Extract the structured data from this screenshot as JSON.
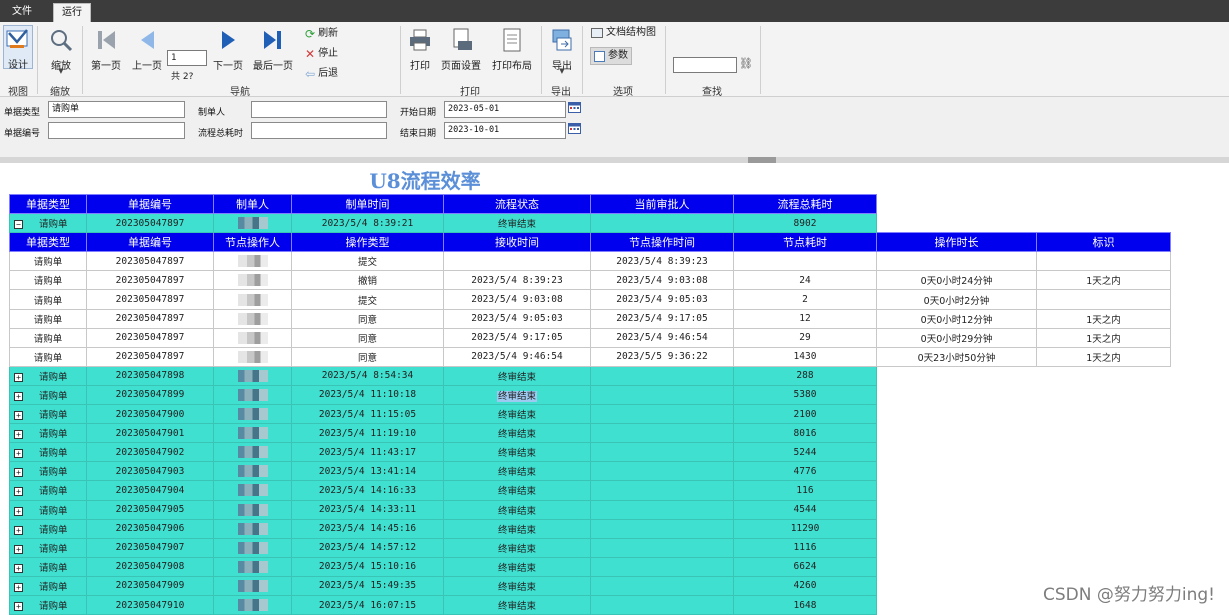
{
  "menu": {
    "file": "文件",
    "run": "运行"
  },
  "ribbon": {
    "design": "设计",
    "zoom": "缩放",
    "first_page": "第一页",
    "prev_page": "上一页",
    "next_page": "下一页",
    "last_page": "最后一页",
    "page_value": "1",
    "page_total": "共 2?",
    "refresh": "刷新",
    "stop": "停止",
    "back": "后退",
    "print": "打印",
    "page_setup": "页面设置",
    "print_layout": "打印布局",
    "export": "导出",
    "doc_structure": "文档结构图",
    "params": "参数",
    "groups": {
      "view": "视图",
      "zoom": "缩放",
      "nav": "导航",
      "print": "打印",
      "export": "导出",
      "options": "选项",
      "find": "查找"
    }
  },
  "filters": {
    "doc_type_label": "单据类型",
    "doc_type_value": "请购单",
    "doc_no_label": "单据编号",
    "doc_no_value": "",
    "creator_label": "制单人",
    "creator_value": "",
    "total_time_label": "流程总耗时",
    "total_time_value": "",
    "start_date_label": "开始日期",
    "start_date_value": "2023-05-01",
    "end_date_label": "结束日期",
    "end_date_value": "2023-10-01"
  },
  "report": {
    "title": "U8流程效率",
    "header1": [
      "单据类型",
      "单据编号",
      "制单人",
      "制单时间",
      "流程状态",
      "当前审批人",
      "流程总耗时"
    ],
    "expanded_row": {
      "type": "请购单",
      "no": "202305047897",
      "time": "2023/5/4 8:39:21",
      "status": "终审结束",
      "approver": "",
      "total": "8902"
    },
    "header2": [
      "单据类型",
      "单据编号",
      "节点操作人",
      "操作类型",
      "接收时间",
      "节点操作时间",
      "节点耗时",
      "操作时长",
      "标识"
    ],
    "detail_rows": [
      {
        "type": "请购单",
        "no": "202305047897",
        "op": "提交",
        "recv": "",
        "optime": "2023/5/4 8:39:23",
        "cost": "",
        "dur": "",
        "flag": ""
      },
      {
        "type": "请购单",
        "no": "202305047897",
        "op": "撤销",
        "recv": "2023/5/4 8:39:23",
        "optime": "2023/5/4 9:03:08",
        "cost": "24",
        "dur": "0天0小时24分钟",
        "flag": "1天之内"
      },
      {
        "type": "请购单",
        "no": "202305047897",
        "op": "提交",
        "recv": "2023/5/4 9:03:08",
        "optime": "2023/5/4 9:05:03",
        "cost": "2",
        "dur": "0天0小时2分钟",
        "flag": ""
      },
      {
        "type": "请购单",
        "no": "202305047897",
        "op": "同意",
        "recv": "2023/5/4 9:05:03",
        "optime": "2023/5/4 9:17:05",
        "cost": "12",
        "dur": "0天0小时12分钟",
        "flag": "1天之内"
      },
      {
        "type": "请购单",
        "no": "202305047897",
        "op": "同意",
        "recv": "2023/5/4 9:17:05",
        "optime": "2023/5/4 9:46:54",
        "cost": "29",
        "dur": "0天0小时29分钟",
        "flag": "1天之内"
      },
      {
        "type": "请购单",
        "no": "202305047897",
        "op": "同意",
        "recv": "2023/5/4 9:46:54",
        "optime": "2023/5/5 9:36:22",
        "cost": "1430",
        "dur": "0天23小时50分钟",
        "flag": "1天之内"
      }
    ],
    "summary_rows": [
      {
        "type": "请购单",
        "no": "202305047898",
        "time": "2023/5/4 8:54:34",
        "status": "终审结束",
        "total": "288"
      },
      {
        "type": "请购单",
        "no": "202305047899",
        "time": "2023/5/4 11:10:18",
        "status": "终审结束",
        "total": "5380"
      },
      {
        "type": "请购单",
        "no": "202305047900",
        "time": "2023/5/4 11:15:05",
        "status": "终审结束",
        "total": "2100"
      },
      {
        "type": "请购单",
        "no": "202305047901",
        "time": "2023/5/4 11:19:10",
        "status": "终审结束",
        "total": "8016"
      },
      {
        "type": "请购单",
        "no": "202305047902",
        "time": "2023/5/4 11:43:17",
        "status": "终审结束",
        "total": "5244"
      },
      {
        "type": "请购单",
        "no": "202305047903",
        "time": "2023/5/4 13:41:14",
        "status": "终审结束",
        "total": "4776"
      },
      {
        "type": "请购单",
        "no": "202305047904",
        "time": "2023/5/4 14:16:33",
        "status": "终审结束",
        "total": "116"
      },
      {
        "type": "请购单",
        "no": "202305047905",
        "time": "2023/5/4 14:33:11",
        "status": "终审结束",
        "total": "4544"
      },
      {
        "type": "请购单",
        "no": "202305047906",
        "time": "2023/5/4 14:45:16",
        "status": "终审结束",
        "total": "11290"
      },
      {
        "type": "请购单",
        "no": "202305047907",
        "time": "2023/5/4 14:57:12",
        "status": "终审结束",
        "total": "1116"
      },
      {
        "type": "请购单",
        "no": "202305047908",
        "time": "2023/5/4 15:10:16",
        "status": "终审结束",
        "total": "6624"
      },
      {
        "type": "请购单",
        "no": "202305047909",
        "time": "2023/5/4 15:49:35",
        "status": "终审结束",
        "total": "4260"
      },
      {
        "type": "请购单",
        "no": "202305047910",
        "time": "2023/5/4 16:07:15",
        "status": "终审结束",
        "total": "1648"
      }
    ]
  },
  "colors": {
    "header_blue": "#0000ee",
    "summary_cyan": "#40e0d0",
    "title_blue": "#5b8fd8"
  },
  "watermark": "CSDN @努力努力ing!"
}
